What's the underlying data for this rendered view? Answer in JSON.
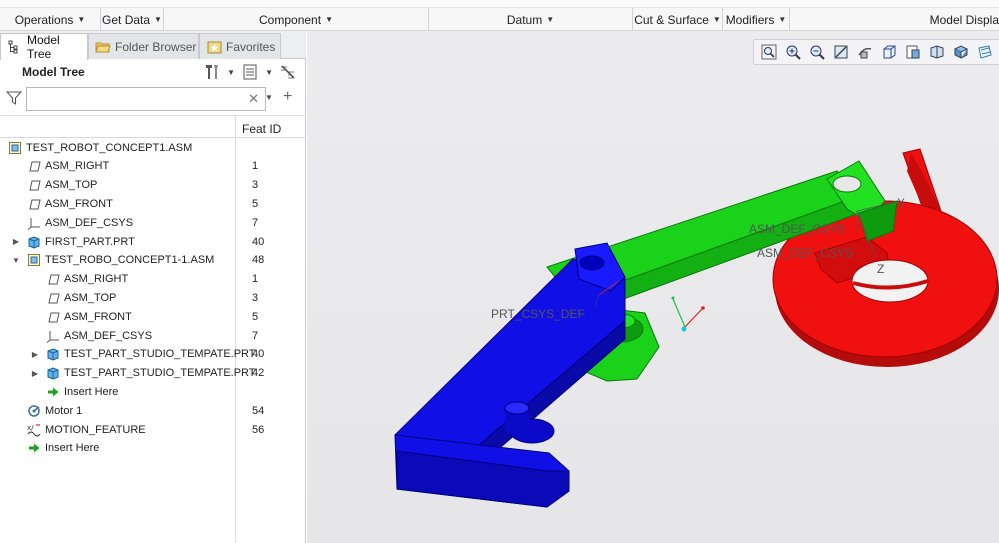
{
  "ribbon": {
    "groups": [
      {
        "label": "Operations"
      },
      {
        "label": "Get Data"
      },
      {
        "label": "Component"
      },
      {
        "label": "Datum"
      },
      {
        "label": "Cut & Surface"
      },
      {
        "label": "Modifiers"
      },
      {
        "label": "Model Displa"
      }
    ]
  },
  "panel": {
    "tabs": [
      {
        "label": "Model Tree",
        "icon": "model-tree-icon"
      },
      {
        "label": "Folder Browser",
        "icon": "folder-icon"
      },
      {
        "label": "Favorites",
        "icon": "favorites-icon"
      }
    ],
    "title": "Model Tree",
    "search": {
      "value": "",
      "placeholder": ""
    },
    "column_header": "Feat ID",
    "rows": [
      {
        "label": "TEST_ROBOT_CONCEPT1.ASM",
        "id": "",
        "icon": "assembly-icon",
        "level": 0,
        "expander": ""
      },
      {
        "label": "ASM_RIGHT",
        "id": "1",
        "icon": "datum-plane-icon",
        "level": 1,
        "expander": ""
      },
      {
        "label": "ASM_TOP",
        "id": "3",
        "icon": "datum-plane-icon",
        "level": 1,
        "expander": ""
      },
      {
        "label": "ASM_FRONT",
        "id": "5",
        "icon": "datum-plane-icon",
        "level": 1,
        "expander": ""
      },
      {
        "label": "ASM_DEF_CSYS",
        "id": "7",
        "icon": "csys-icon",
        "level": 1,
        "expander": ""
      },
      {
        "label": "FIRST_PART.PRT",
        "id": "40",
        "icon": "part-icon",
        "level": 1,
        "expander": "collapsed"
      },
      {
        "label": "TEST_ROBO_CONCEPT1-1.ASM",
        "id": "48",
        "icon": "assembly-icon",
        "level": 1,
        "expander": "expanded"
      },
      {
        "label": "ASM_RIGHT",
        "id": "1",
        "icon": "datum-plane-icon",
        "level": 2,
        "expander": ""
      },
      {
        "label": "ASM_TOP",
        "id": "3",
        "icon": "datum-plane-icon",
        "level": 2,
        "expander": ""
      },
      {
        "label": "ASM_FRONT",
        "id": "5",
        "icon": "datum-plane-icon",
        "level": 2,
        "expander": ""
      },
      {
        "label": "ASM_DEF_CSYS",
        "id": "7",
        "icon": "csys-icon",
        "level": 2,
        "expander": ""
      },
      {
        "label": "TEST_PART_STUDIO_TEMPATE.PRT",
        "id": "40",
        "icon": "part-icon",
        "level": 2,
        "expander": "collapsed"
      },
      {
        "label": "TEST_PART_STUDIO_TEMPATE.PRT",
        "id": "42",
        "icon": "part-icon",
        "level": 2,
        "expander": "collapsed"
      },
      {
        "label": "Insert Here",
        "id": "",
        "icon": "insert-arrow-icon",
        "level": 2,
        "expander": ""
      },
      {
        "label": "Motor 1",
        "id": "54",
        "icon": "motor-icon",
        "level": 1,
        "expander": ""
      },
      {
        "label": "MOTION_FEATURE",
        "id": "56",
        "icon": "motion-feature-icon",
        "level": 1,
        "expander": ""
      },
      {
        "label": "Insert Here",
        "id": "",
        "icon": "insert-arrow-icon",
        "level": 1,
        "expander": ""
      }
    ]
  },
  "viewport": {
    "labels": {
      "prt_csys": "PRT_CSYS_DEF",
      "asm_csys": "ASM_DEF_CSYS",
      "csys_x": "X",
      "csys_z": "Z"
    },
    "toolbar_icons": [
      "zoom-refit-icon",
      "zoom-in-icon",
      "zoom-out-icon",
      "repaint-icon",
      "reorient-icon",
      "saved-views-icon",
      "display-style-icon",
      "perspective-icon",
      "view-manager-icon",
      "datum-display-icon"
    ],
    "colors": {
      "blue": "#1010e6",
      "green": "#19e619",
      "red": "#f01010"
    }
  }
}
